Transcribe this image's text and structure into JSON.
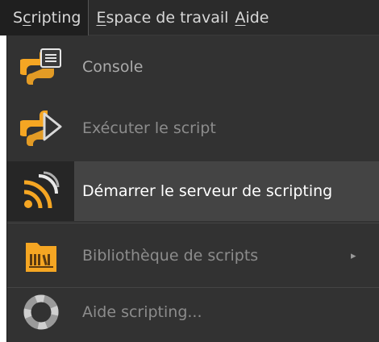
{
  "menubar": {
    "items": [
      {
        "pre": "S",
        "u": "c",
        "post": "ripting"
      },
      {
        "pre": "",
        "u": "E",
        "post": "space de travail"
      },
      {
        "pre": "",
        "u": "A",
        "post": "ide"
      }
    ]
  },
  "menu": {
    "items": [
      {
        "label": "Console",
        "icon": "python-console-icon"
      },
      {
        "label": "Exécuter le script",
        "icon": "python-run-icon"
      },
      {
        "label": "Démarrer le serveur de scripting",
        "icon": "rss-server-icon"
      },
      {
        "label": "Bibliothèque de scripts",
        "icon": "library-folder-icon",
        "submenu_arrow": "▸"
      },
      {
        "label": "Aide scripting...",
        "icon": "lifebuoy-help-icon"
      }
    ]
  },
  "colors": {
    "python_orange": "#f5a623",
    "menubar_bg": "#2b2b2b",
    "menu_bg": "#323232",
    "highlight_bg": "#444444"
  }
}
